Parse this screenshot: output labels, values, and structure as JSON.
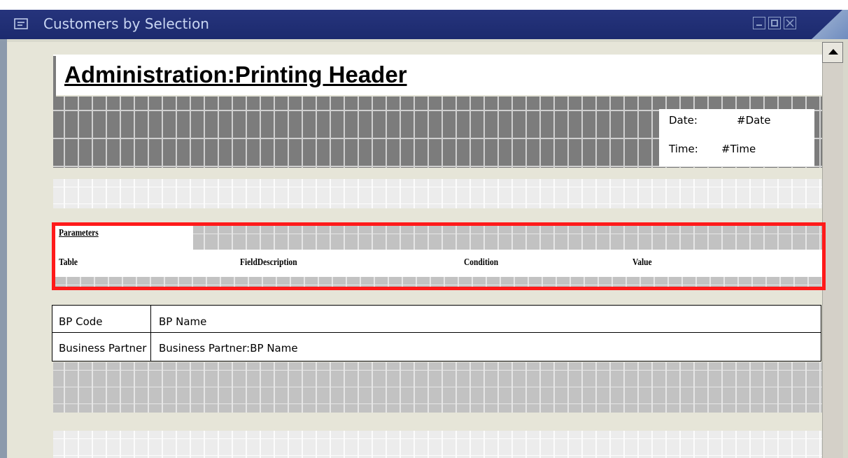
{
  "window": {
    "title": "Customers by Selection"
  },
  "header": {
    "title": "Administration:Printing Header",
    "date_label": "Date:",
    "date_value": "#Date",
    "time_label": "Time:",
    "time_value": "#Time"
  },
  "parameters": {
    "title": "Parameters",
    "columns": [
      "Table",
      "FieldDescription",
      "Condition",
      "Value"
    ]
  },
  "table": {
    "headers": [
      "BP Code",
      "BP Name"
    ],
    "row": [
      "Business Partner",
      "Business Partner:BP Name"
    ]
  },
  "colors": {
    "title_bar": "#26347c",
    "highlight": "#ff1a1a"
  }
}
